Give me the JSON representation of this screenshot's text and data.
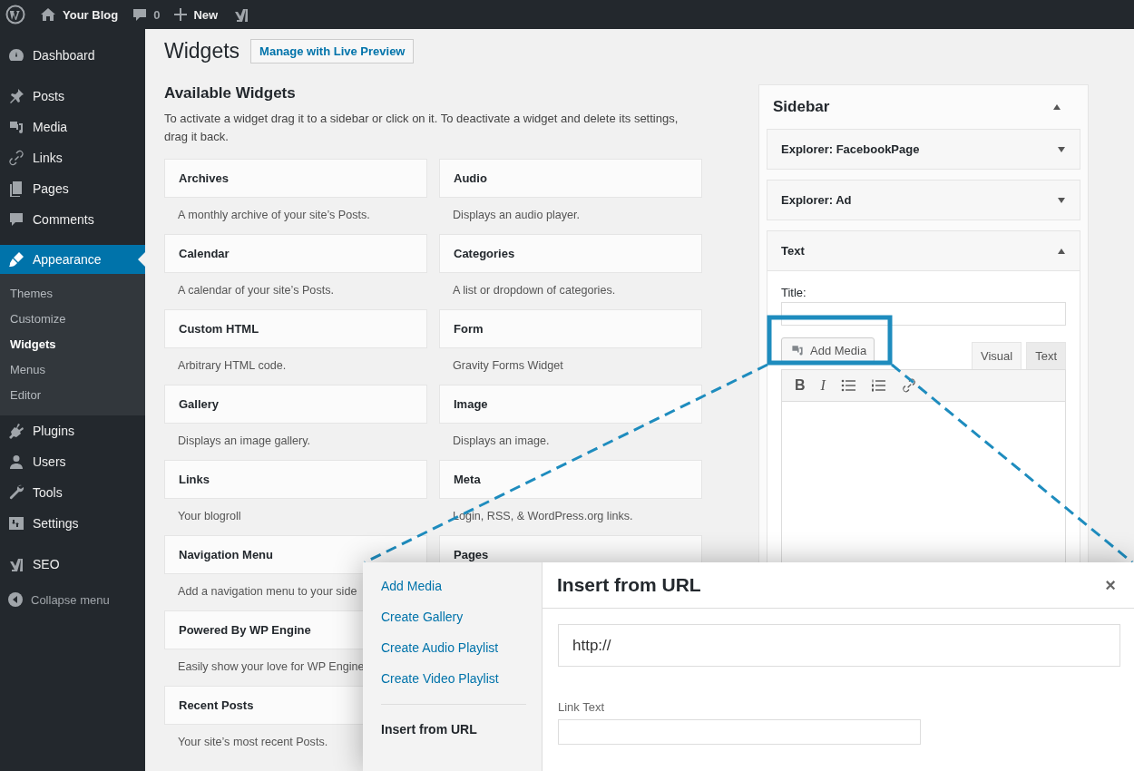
{
  "toolbar": {
    "site": "Your Blog",
    "comments": "0",
    "new": "New"
  },
  "admin_menu": {
    "groups": [
      [
        {
          "label": "Dashboard",
          "selected": false
        }
      ],
      [
        {
          "label": "Posts",
          "selected": false
        },
        {
          "label": "Media",
          "selected": false
        },
        {
          "label": "Links",
          "selected": false
        },
        {
          "label": "Pages",
          "selected": false
        },
        {
          "label": "Comments",
          "selected": false
        }
      ],
      [
        {
          "label": "Appearance",
          "selected": true,
          "children": [
            {
              "label": "Themes",
              "selected": false
            },
            {
              "label": "Customize",
              "selected": false
            },
            {
              "label": "Widgets",
              "selected": true
            },
            {
              "label": "Menus",
              "selected": false
            },
            {
              "label": "Editor",
              "selected": false
            }
          ]
        },
        {
          "label": "Plugins",
          "selected": false
        },
        {
          "label": "Users",
          "selected": false
        },
        {
          "label": "Tools",
          "selected": false
        },
        {
          "label": "Settings",
          "selected": false
        }
      ],
      [
        {
          "label": "SEO",
          "selected": false
        }
      ]
    ],
    "collapse": "Collapse menu"
  },
  "page": {
    "title": "Widgets",
    "action": "Manage with Live Preview"
  },
  "available_widgets": {
    "heading": "Available Widgets",
    "description": "To activate a widget drag it to a sidebar or click on it. To deactivate a widget and delete its settings, drag it back.",
    "left_column": [
      {
        "name": "Archives",
        "description": "A monthly archive of your site’s Posts."
      },
      {
        "name": "Calendar",
        "description": "A calendar of your site’s Posts."
      },
      {
        "name": "Custom HTML",
        "description": "Arbitrary HTML code."
      },
      {
        "name": "Gallery",
        "description": "Displays an image gallery."
      },
      {
        "name": "Links",
        "description": "Your blogroll"
      },
      {
        "name": "Navigation Menu",
        "description": "Add a navigation menu to your side"
      },
      {
        "name": "Powered By WP Engine",
        "description": "Easily show your love for WP Engine"
      },
      {
        "name": "Recent Posts",
        "description": "Your site’s most recent Posts."
      }
    ],
    "right_column": [
      {
        "name": "Audio",
        "description": "Displays an audio player."
      },
      {
        "name": "Categories",
        "description": "A list or dropdown of categories."
      },
      {
        "name": "Form",
        "description": "Gravity Forms Widget"
      },
      {
        "name": "Image",
        "description": "Displays an image."
      },
      {
        "name": "Meta",
        "description": "Login, RSS, & WordPress.org links."
      },
      {
        "name": "Pages"
      }
    ]
  },
  "sidebar": {
    "title": "Sidebar",
    "expanded": true,
    "widgets": [
      {
        "name": "Explorer: FacebookPage",
        "expanded": false
      },
      {
        "name": "Explorer: Ad",
        "expanded": false
      },
      {
        "name": "Text",
        "expanded": true,
        "title_label": "Title:",
        "add_media": "Add Media",
        "tabs": [
          {
            "label": "Visual",
            "selected": true
          },
          {
            "label": "Text",
            "selected": false
          }
        ],
        "format_buttons": [
          "B",
          "I"
        ]
      }
    ]
  },
  "modal": {
    "menu": [
      {
        "label": "Add Media",
        "selected": false
      },
      {
        "label": "Create Gallery",
        "selected": false
      },
      {
        "label": "Create Audio Playlist",
        "selected": false
      },
      {
        "label": "Create Video Playlist",
        "selected": false
      },
      {
        "label": "Insert from URL",
        "selected": true
      }
    ],
    "title": "Insert from URL",
    "close": "×",
    "url_value": "http://",
    "link_text_label": "Link Text"
  }
}
